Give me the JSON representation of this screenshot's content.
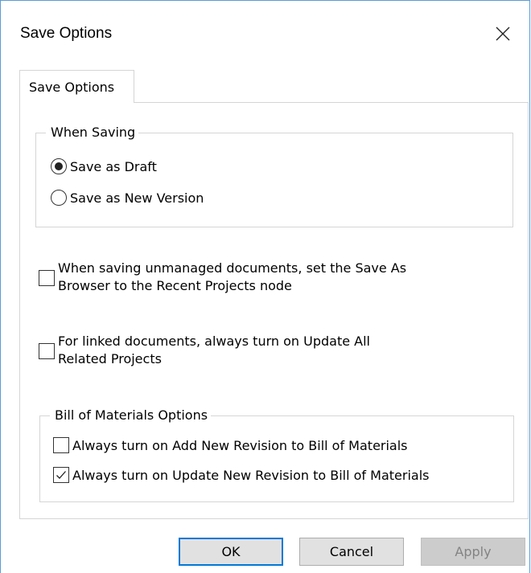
{
  "window": {
    "title": "Save Options",
    "close_icon": "close-icon"
  },
  "tab": {
    "label": "Save Options"
  },
  "when_saving": {
    "legend": "When Saving",
    "options": [
      {
        "label": "Save as Draft",
        "selected": true
      },
      {
        "label": "Save as New Version",
        "selected": false
      }
    ]
  },
  "checkboxes": [
    {
      "line1": "When saving unmanaged documents, set the Save As",
      "line2": "Browser to the Recent Projects node",
      "checked": false
    },
    {
      "line1": "For linked documents, always turn on Update All",
      "line2": "Related Projects",
      "checked": false
    }
  ],
  "bom": {
    "legend": "Bill of Materials Options",
    "options": [
      {
        "label": "Always turn on Add New Revision to Bill of Materials",
        "checked": false
      },
      {
        "label": "Always turn on Update New Revision to Bill of Materials",
        "checked": true
      }
    ]
  },
  "buttons": {
    "ok": "OK",
    "cancel": "Cancel",
    "apply": "Apply"
  },
  "colors": {
    "window_border": "#5b9bd5",
    "default_button_border": "#0078d7",
    "button_face": "#e1e1e1"
  }
}
